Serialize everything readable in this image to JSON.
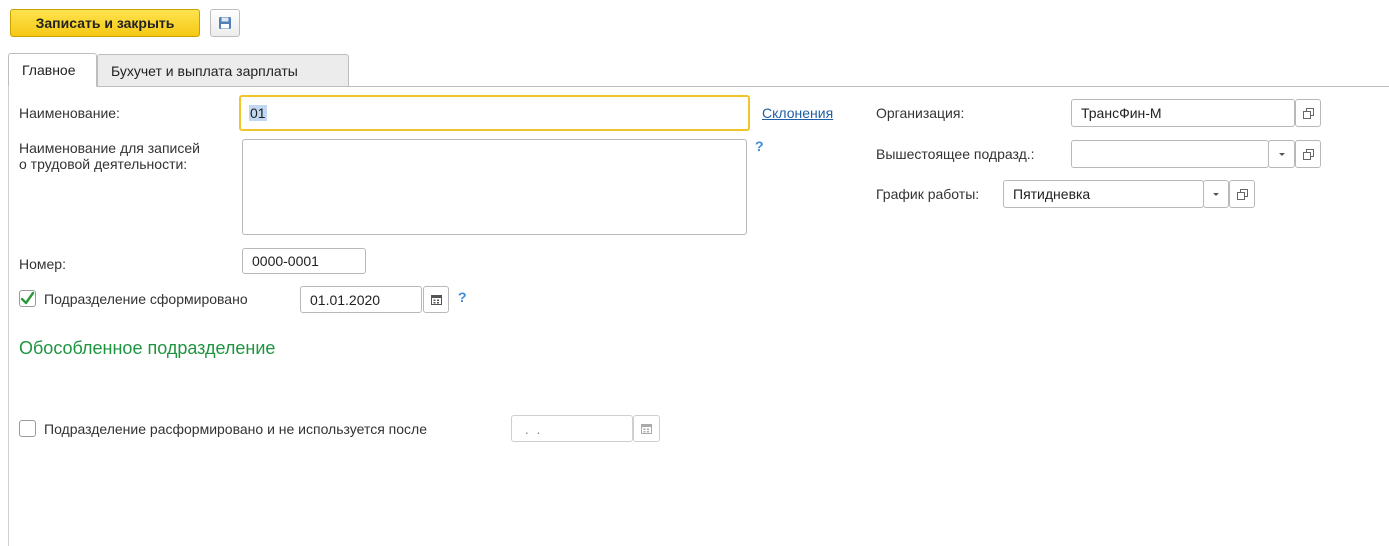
{
  "toolbar": {
    "save_close_label": "Записать и закрыть",
    "save_icon": "floppy-disk-icon"
  },
  "tabs": [
    {
      "label": "Главное",
      "active": true
    },
    {
      "label": "Бухучет и выплата зарплаты",
      "active": false
    }
  ],
  "form": {
    "name_label": "Наименование:",
    "name_value": "01",
    "declension_link": "Склонения",
    "labor_name_label_line1": "Наименование для записей",
    "labor_name_label_line2": "о трудовой деятельности:",
    "labor_name_value": "",
    "labor_help": "?",
    "number_label": "Номер:",
    "number_value": "0000-0001",
    "formed_label": "Подразделение сформировано",
    "formed_checked": true,
    "formed_date": "01.01.2020",
    "formed_help": "?",
    "separate_title": "Обособленное подразделение",
    "disbanded_label": "Подразделение расформировано и не используется после",
    "disbanded_checked": false,
    "disbanded_date": " .  .",
    "org_label": "Организация:",
    "org_value": "ТрансФин-М",
    "parent_label": "Вышестоящее подразд.:",
    "parent_value": "",
    "schedule_label": "График работы:",
    "schedule_value": "Пятидневка"
  },
  "colors": {
    "primary_button": "#f5c816",
    "focus_border": "#f0c52c",
    "link": "#1f5fa6",
    "section_title": "#1e9440",
    "help": "#3d8bd9"
  }
}
